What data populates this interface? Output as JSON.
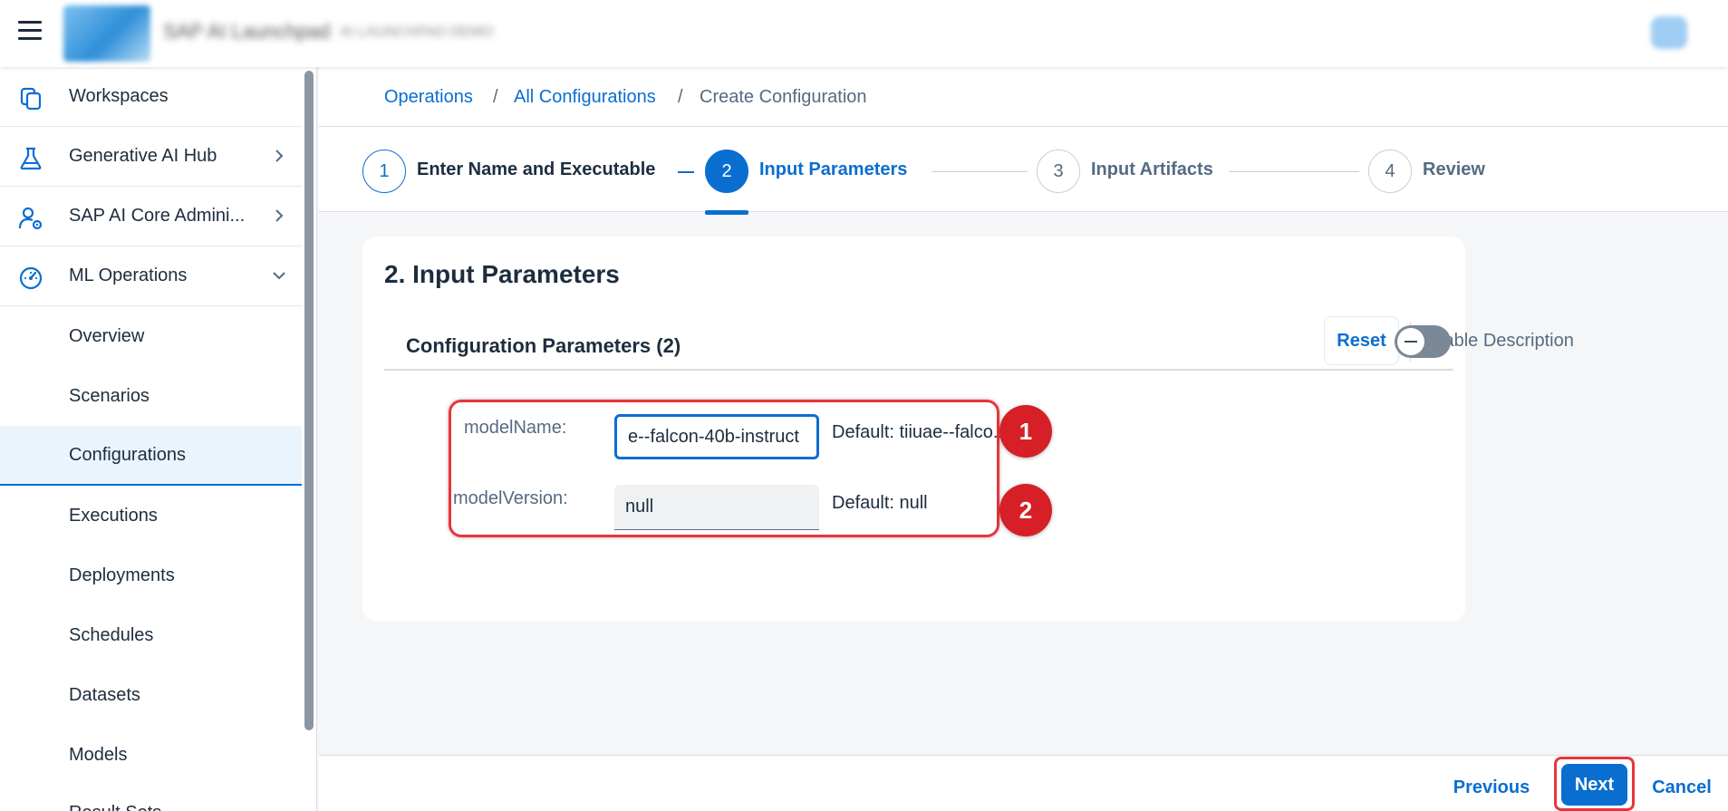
{
  "shell": {
    "title": "SAP AI Launchpad",
    "subtitle": "AI LAUNCHPAD DEMO"
  },
  "sidebar": {
    "items": [
      {
        "label": "Workspaces",
        "icon": "workspaces-icon",
        "has_chevron": false
      },
      {
        "label": "Generative AI Hub",
        "icon": "flask-icon",
        "has_chevron": true,
        "chevron": "right"
      },
      {
        "label": "SAP AI Core Admini...",
        "icon": "user-settings-icon",
        "has_chevron": true,
        "chevron": "right"
      },
      {
        "label": "ML Operations",
        "icon": "speedometer-icon",
        "has_chevron": true,
        "chevron": "down"
      }
    ],
    "sub_items": [
      {
        "label": "Overview"
      },
      {
        "label": "Scenarios"
      },
      {
        "label": "Configurations",
        "selected": true
      },
      {
        "label": "Executions"
      },
      {
        "label": "Deployments"
      },
      {
        "label": "Schedules"
      },
      {
        "label": "Datasets"
      },
      {
        "label": "Models"
      },
      {
        "label": "Result Sets"
      }
    ]
  },
  "breadcrumb": {
    "items": [
      "Operations",
      "All Configurations",
      "Create Configuration"
    ],
    "separator": "/"
  },
  "steps": [
    {
      "number": "1",
      "label": "Enter Name and Executable",
      "state": "done"
    },
    {
      "number": "2",
      "label": "Input Parameters",
      "state": "active"
    },
    {
      "number": "3",
      "label": "Input Artifacts",
      "state": "pending"
    },
    {
      "number": "4",
      "label": "Review",
      "state": "pending"
    }
  ],
  "section": {
    "title": "2. Input Parameters",
    "params_title": "Configuration Parameters (2)",
    "reset_label": "Reset",
    "enable_description_label": "Enable Description",
    "enable_description_on": false
  },
  "params": [
    {
      "label": "modelName:",
      "value": "e--falcon-40b-instruct",
      "default": "Default: tiiuae--falco..."
    },
    {
      "label": "modelVersion:",
      "value": "null",
      "default": "Default: null"
    }
  ],
  "markers": [
    "1",
    "2"
  ],
  "footer": {
    "previous": "Previous",
    "next": "Next",
    "cancel": "Cancel"
  },
  "colors": {
    "accent": "#0a6ed1",
    "highlight": "#e8353b",
    "marker": "#d61f26"
  }
}
